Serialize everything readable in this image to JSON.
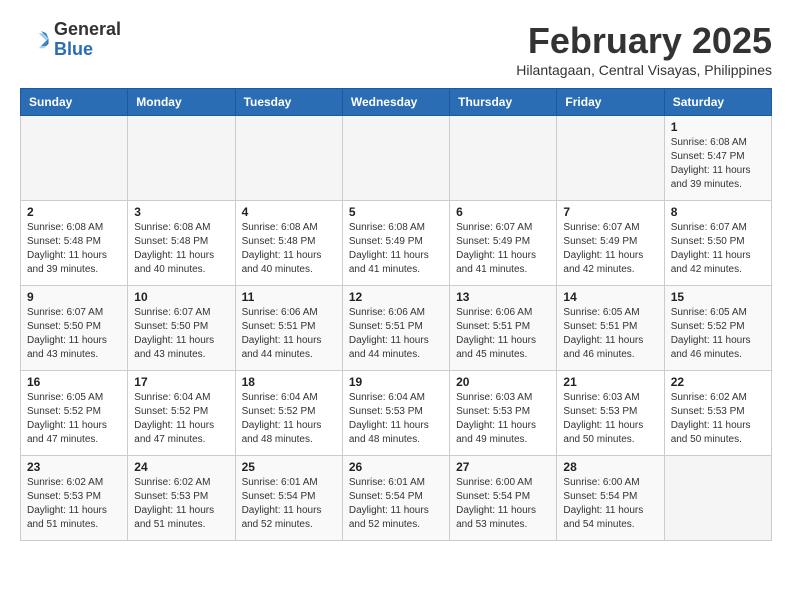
{
  "header": {
    "logo_general": "General",
    "logo_blue": "Blue",
    "month_year": "February 2025",
    "location": "Hilantagaan, Central Visayas, Philippines"
  },
  "calendar": {
    "weekdays": [
      "Sunday",
      "Monday",
      "Tuesday",
      "Wednesday",
      "Thursday",
      "Friday",
      "Saturday"
    ],
    "weeks": [
      [
        {
          "day": "",
          "info": ""
        },
        {
          "day": "",
          "info": ""
        },
        {
          "day": "",
          "info": ""
        },
        {
          "day": "",
          "info": ""
        },
        {
          "day": "",
          "info": ""
        },
        {
          "day": "",
          "info": ""
        },
        {
          "day": "1",
          "info": "Sunrise: 6:08 AM\nSunset: 5:47 PM\nDaylight: 11 hours\nand 39 minutes."
        }
      ],
      [
        {
          "day": "2",
          "info": "Sunrise: 6:08 AM\nSunset: 5:48 PM\nDaylight: 11 hours\nand 39 minutes."
        },
        {
          "day": "3",
          "info": "Sunrise: 6:08 AM\nSunset: 5:48 PM\nDaylight: 11 hours\nand 40 minutes."
        },
        {
          "day": "4",
          "info": "Sunrise: 6:08 AM\nSunset: 5:48 PM\nDaylight: 11 hours\nand 40 minutes."
        },
        {
          "day": "5",
          "info": "Sunrise: 6:08 AM\nSunset: 5:49 PM\nDaylight: 11 hours\nand 41 minutes."
        },
        {
          "day": "6",
          "info": "Sunrise: 6:07 AM\nSunset: 5:49 PM\nDaylight: 11 hours\nand 41 minutes."
        },
        {
          "day": "7",
          "info": "Sunrise: 6:07 AM\nSunset: 5:49 PM\nDaylight: 11 hours\nand 42 minutes."
        },
        {
          "day": "8",
          "info": "Sunrise: 6:07 AM\nSunset: 5:50 PM\nDaylight: 11 hours\nand 42 minutes."
        }
      ],
      [
        {
          "day": "9",
          "info": "Sunrise: 6:07 AM\nSunset: 5:50 PM\nDaylight: 11 hours\nand 43 minutes."
        },
        {
          "day": "10",
          "info": "Sunrise: 6:07 AM\nSunset: 5:50 PM\nDaylight: 11 hours\nand 43 minutes."
        },
        {
          "day": "11",
          "info": "Sunrise: 6:06 AM\nSunset: 5:51 PM\nDaylight: 11 hours\nand 44 minutes."
        },
        {
          "day": "12",
          "info": "Sunrise: 6:06 AM\nSunset: 5:51 PM\nDaylight: 11 hours\nand 44 minutes."
        },
        {
          "day": "13",
          "info": "Sunrise: 6:06 AM\nSunset: 5:51 PM\nDaylight: 11 hours\nand 45 minutes."
        },
        {
          "day": "14",
          "info": "Sunrise: 6:05 AM\nSunset: 5:51 PM\nDaylight: 11 hours\nand 46 minutes."
        },
        {
          "day": "15",
          "info": "Sunrise: 6:05 AM\nSunset: 5:52 PM\nDaylight: 11 hours\nand 46 minutes."
        }
      ],
      [
        {
          "day": "16",
          "info": "Sunrise: 6:05 AM\nSunset: 5:52 PM\nDaylight: 11 hours\nand 47 minutes."
        },
        {
          "day": "17",
          "info": "Sunrise: 6:04 AM\nSunset: 5:52 PM\nDaylight: 11 hours\nand 47 minutes."
        },
        {
          "day": "18",
          "info": "Sunrise: 6:04 AM\nSunset: 5:52 PM\nDaylight: 11 hours\nand 48 minutes."
        },
        {
          "day": "19",
          "info": "Sunrise: 6:04 AM\nSunset: 5:53 PM\nDaylight: 11 hours\nand 48 minutes."
        },
        {
          "day": "20",
          "info": "Sunrise: 6:03 AM\nSunset: 5:53 PM\nDaylight: 11 hours\nand 49 minutes."
        },
        {
          "day": "21",
          "info": "Sunrise: 6:03 AM\nSunset: 5:53 PM\nDaylight: 11 hours\nand 50 minutes."
        },
        {
          "day": "22",
          "info": "Sunrise: 6:02 AM\nSunset: 5:53 PM\nDaylight: 11 hours\nand 50 minutes."
        }
      ],
      [
        {
          "day": "23",
          "info": "Sunrise: 6:02 AM\nSunset: 5:53 PM\nDaylight: 11 hours\nand 51 minutes."
        },
        {
          "day": "24",
          "info": "Sunrise: 6:02 AM\nSunset: 5:53 PM\nDaylight: 11 hours\nand 51 minutes."
        },
        {
          "day": "25",
          "info": "Sunrise: 6:01 AM\nSunset: 5:54 PM\nDaylight: 11 hours\nand 52 minutes."
        },
        {
          "day": "26",
          "info": "Sunrise: 6:01 AM\nSunset: 5:54 PM\nDaylight: 11 hours\nand 52 minutes."
        },
        {
          "day": "27",
          "info": "Sunrise: 6:00 AM\nSunset: 5:54 PM\nDaylight: 11 hours\nand 53 minutes."
        },
        {
          "day": "28",
          "info": "Sunrise: 6:00 AM\nSunset: 5:54 PM\nDaylight: 11 hours\nand 54 minutes."
        },
        {
          "day": "",
          "info": ""
        }
      ]
    ]
  }
}
